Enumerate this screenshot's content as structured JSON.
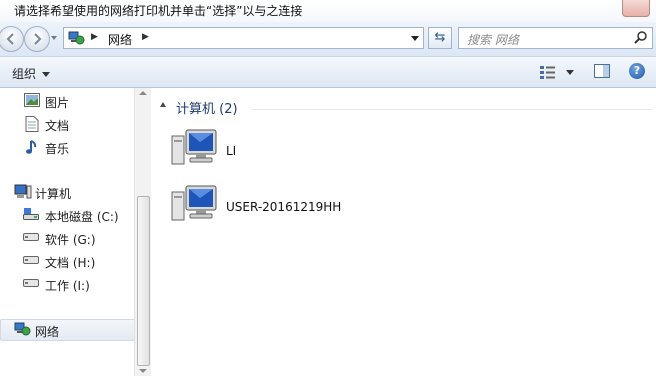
{
  "window": {
    "title": "请选择希望使用的网络打印机并单击“选择”以与之连接"
  },
  "address": {
    "path": [
      "网络"
    ],
    "search_placeholder": "搜索 网络"
  },
  "toolbar": {
    "organize_label": "组织"
  },
  "sidebar": {
    "items": [
      {
        "label": "图片",
        "icon": "pictures-icon"
      },
      {
        "label": "文档",
        "icon": "documents-icon"
      },
      {
        "label": "音乐",
        "icon": "music-icon"
      },
      {
        "label": "计算机",
        "icon": "computer-icon"
      },
      {
        "label": "本地磁盘 (C:)",
        "icon": "system-drive-icon"
      },
      {
        "label": "软件 (G:)",
        "icon": "drive-icon"
      },
      {
        "label": "文档 (H:)",
        "icon": "drive-icon"
      },
      {
        "label": "工作 (I:)",
        "icon": "drive-icon"
      },
      {
        "label": "网络",
        "icon": "network-icon"
      }
    ]
  },
  "content": {
    "group_title": "计算机 (2)",
    "computers": [
      {
        "name": "LI"
      },
      {
        "name": "USER-20161219HH"
      }
    ]
  }
}
